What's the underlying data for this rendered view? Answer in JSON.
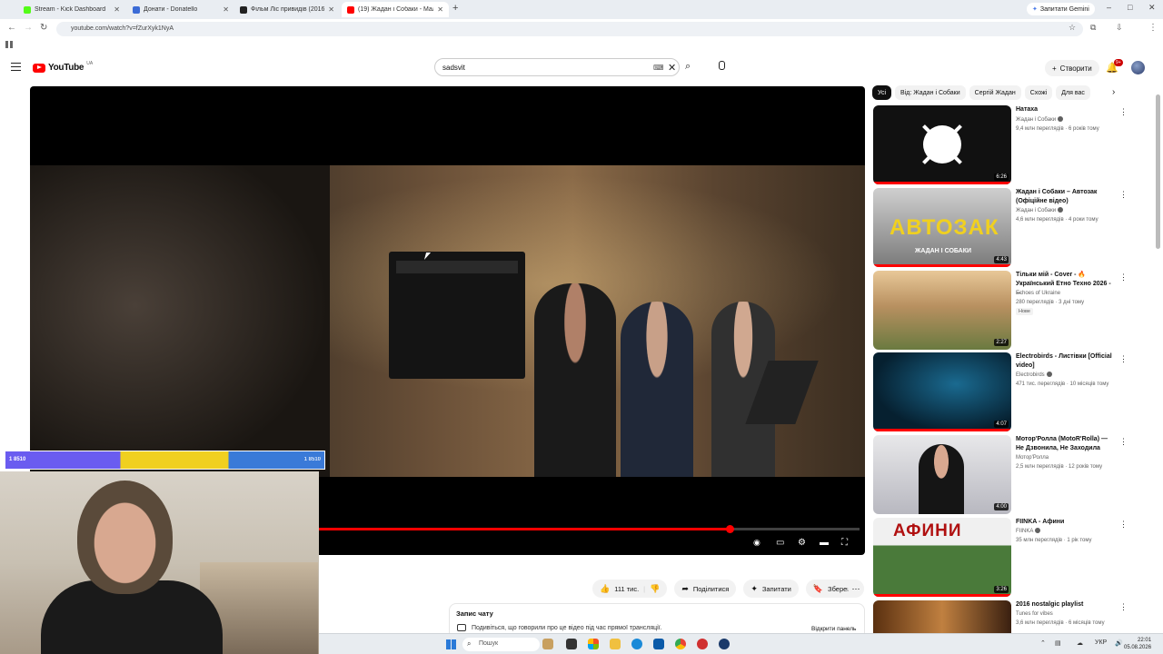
{
  "browser": {
    "tabs": [
      {
        "title": "Stream - Kick Dashboard",
        "favicon_color": "#53fc18"
      },
      {
        "title": "Донати - Donatello",
        "favicon_color": "#3b6bd6"
      },
      {
        "title": "Фільм Ліс привидів (2016) он...",
        "favicon_color": "#222222"
      },
      {
        "title": "(19) Жадан і Собаки - Мал...",
        "favicon_color": "#ff0000"
      }
    ],
    "active_tab_index": 3,
    "new_tab_label": "+",
    "gemini_label": "Запитати Gemini",
    "url": "youtube.com/watch?v=fZurXyk1NyA",
    "window_controls": [
      "–",
      "□",
      "✕"
    ]
  },
  "youtube": {
    "logo_text": "YouTube",
    "country_code": "UA",
    "search": {
      "value": "sadsvit",
      "placeholder": "Пошук"
    },
    "create_label": "Створити",
    "notification_count": "9+",
    "accent_color": "#ff0000"
  },
  "player": {
    "progress_fraction": 0.76,
    "controls": [
      "autoplay-toggle",
      "subtitles",
      "settings",
      "theater",
      "fullscreen"
    ]
  },
  "overlay": {
    "donation_bar_label": "1 8510",
    "donation_bar_right": "1 8510"
  },
  "actions": {
    "likes": "111 тис.",
    "share": "Поділитися",
    "ask": "Запитати",
    "save": "Зберегти"
  },
  "chat_replay": {
    "heading": "Запис чату",
    "text": "Подивіться, що говорили про це відео під час прямої трансляції.",
    "open_label": "Відкрити панель"
  },
  "chips": [
    "Усі",
    "Від: Жадан і Собаки",
    "Сергій Жадан",
    "Схожі",
    "Для вас"
  ],
  "recommended": [
    {
      "title": "Натаха",
      "channel": "Жадан і Собаки",
      "verified": true,
      "views": "9,4 млн переглядів · 6 років тому",
      "duration": "6:26",
      "badge": "",
      "watched": 1.0
    },
    {
      "title": "Жадан і Собаки – Автозак (Офіційне відео)",
      "channel": "Жадан і Собаки",
      "verified": true,
      "views": "4,6 млн переглядів · 4 роки тому",
      "duration": "4:43",
      "badge": "",
      "watched": 1.0,
      "thumb_text": "АВТОЗАК",
      "thumb_sub": "ЖАДАН І СОБАКИ"
    },
    {
      "title": "Тільки мій - Cover - 🔥 Український Етно Техно 2026 - ...",
      "channel": "Echoes of Ukraine",
      "verified": false,
      "views": "280 переглядів · 3 дні тому",
      "duration": "2:27",
      "badge": "Нове",
      "watched": 0
    },
    {
      "title": "Electrobirds - Листівки [Official video]",
      "channel": "Electrobirds",
      "verified": true,
      "views": "471 тис. переглядів · 10 місяців тому",
      "duration": "4:07",
      "badge": "",
      "watched": 1.0
    },
    {
      "title": "Мотор'Ролла (MotoR'Rolla) — Не Дзвонила, Не Заходила",
      "channel": "Мотор'Ролла",
      "verified": false,
      "views": "2,5 млн переглядів · 12 років тому",
      "duration": "4:00",
      "badge": "",
      "watched": 0
    },
    {
      "title": "FIINKA - Афини",
      "channel": "FIINKA",
      "verified": true,
      "views": "35 млн переглядів · 1 рік тому",
      "duration": "3:26",
      "badge": "",
      "watched": 1.0,
      "thumb_text": "АФИНИ"
    },
    {
      "title": "2016 nostalgic playlist",
      "channel": "Tunes for vibes",
      "verified": false,
      "views": "3,6 млн переглядів · 6 місяців тому",
      "duration": "",
      "badge": "",
      "watched": 0
    }
  ],
  "taskbar": {
    "search_label": "Пошук",
    "language": "УКР",
    "time": "22:01",
    "date": "05.08.2026"
  }
}
